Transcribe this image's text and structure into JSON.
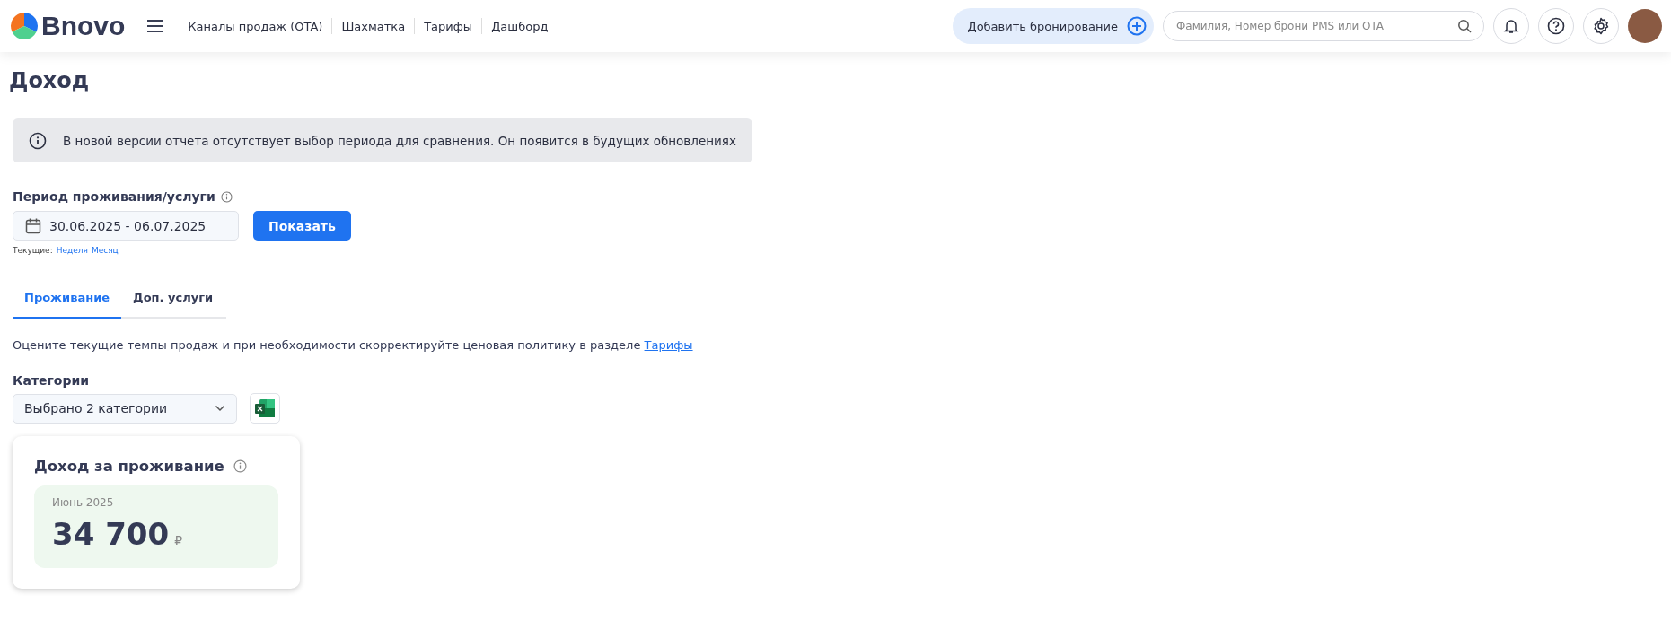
{
  "header": {
    "logo": "Bnovo",
    "nav": [
      "Каналы продаж (OTA)",
      "Шахматка",
      "Тарифы",
      "Дашборд"
    ],
    "add_booking": "Добавить бронирование",
    "search": {
      "placeholder": "Фамилия, Номер брони PMS или OTA"
    }
  },
  "page_title": "Доход",
  "notice": "В новой версии отчета отсутствует выбор периода для сравнения. Он появится в будущих обновлениях",
  "period": {
    "label": "Период проживания/услуги",
    "value": "30.06.2025 - 06.07.2025",
    "button": "Показать",
    "current_label": "Текущие:",
    "current_links": [
      "Неделя",
      "Месяц"
    ]
  },
  "tabs": [
    {
      "label": "Проживание",
      "selected": true
    },
    {
      "label": "Доп. услуги",
      "selected": false
    }
  ],
  "hint": {
    "text": "Оцените текущие темпы продаж и при необходимости скорректируйте ценовая политику в разделе ",
    "link": "Тарифы"
  },
  "categories": {
    "label": "Категории",
    "value": "Выбрано 2 категории"
  },
  "income_card": {
    "title": "Доход за проживание",
    "period": "Июнь 2025",
    "amount": "34 700",
    "currency": "₽"
  }
}
